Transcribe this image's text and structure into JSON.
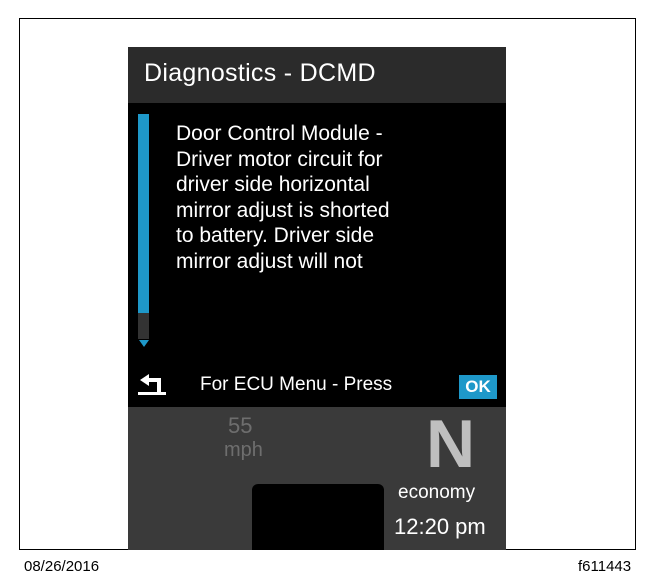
{
  "screen": {
    "title": "Diagnostics - DCMD",
    "message_lines": [
      "Door Control Module -",
      "Driver motor circuit for",
      "driver side horizontal",
      "mirror adjust is shorted",
      "to battery. Driver side",
      "mirror adjust will not"
    ],
    "hint": "For ECU Menu - Press",
    "ok_label": "OK"
  },
  "cluster": {
    "speed_value": "55",
    "speed_unit": "mph",
    "gear": "N",
    "mode": "economy",
    "time": "12:20 pm"
  },
  "captions": {
    "date": "08/26/2016",
    "figure_id": "f611443"
  },
  "colors": {
    "accent": "#1e98c9",
    "screen_bg": "#000000",
    "title_bg": "#2b2b2b",
    "cluster_bg": "#3a3a3a"
  },
  "icons": {
    "back": "back-arrow-icon",
    "scroll_down": "scroll-down-arrow-icon"
  }
}
